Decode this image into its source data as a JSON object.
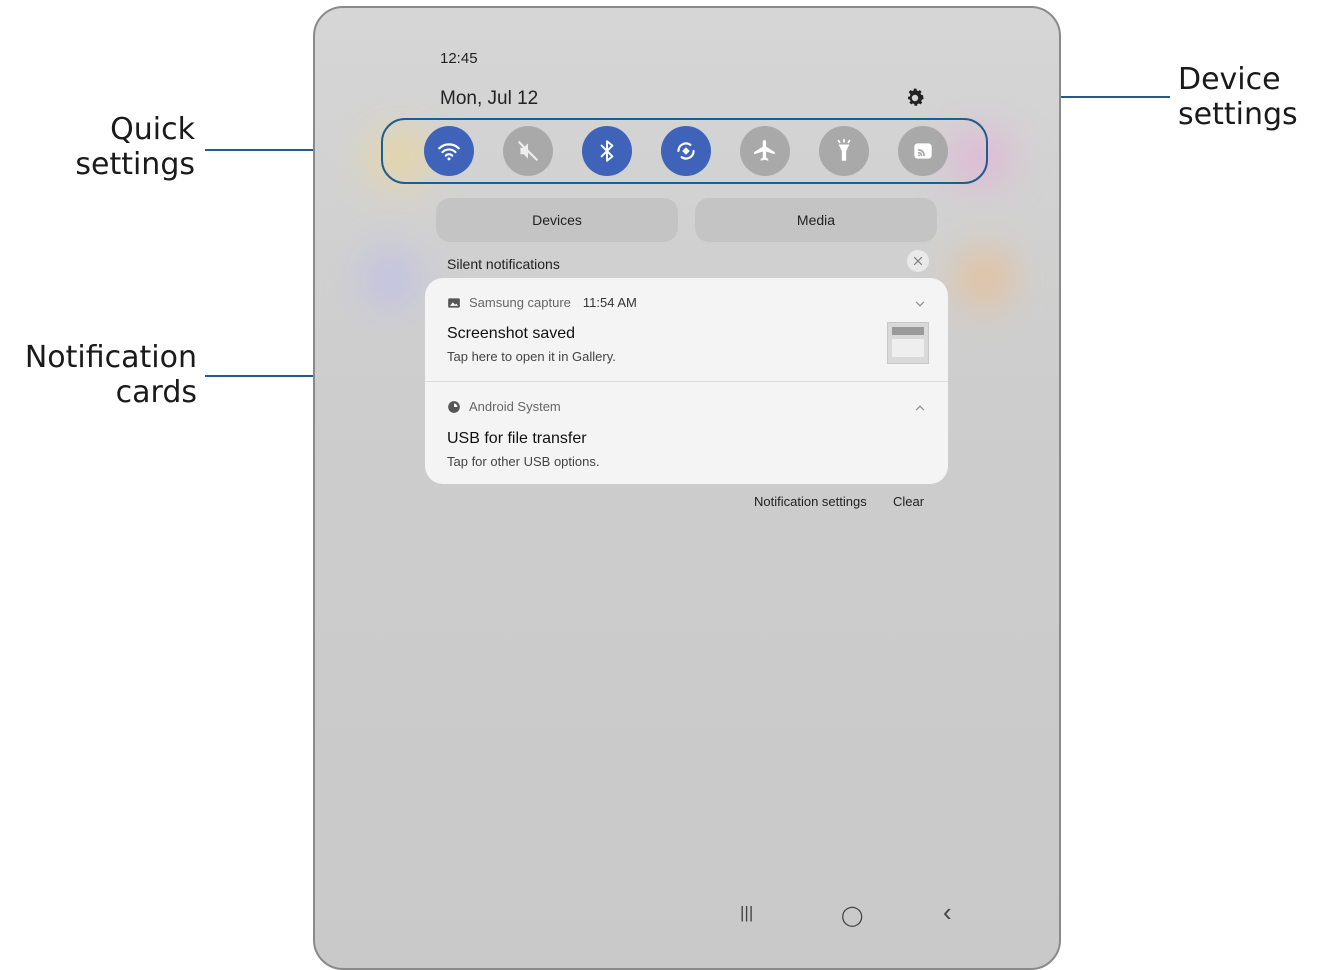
{
  "callouts": {
    "quick_settings_line1": "Quick",
    "quick_settings_line2": "settings",
    "notification_cards_line1": "Notification",
    "notification_cards_line2": "cards",
    "device_settings_line1": "Device",
    "device_settings_line2": "settings",
    "accent_color": "#1f5d8c"
  },
  "status_bar": {
    "time": "12:45"
  },
  "header": {
    "date": "Mon, Jul 12",
    "settings_icon": "gear-icon"
  },
  "quick_settings": [
    {
      "name": "wifi",
      "icon": "wifi-icon",
      "state": "on"
    },
    {
      "name": "sound",
      "icon": "mute-icon",
      "state": "off"
    },
    {
      "name": "bluetooth",
      "icon": "bluetooth-icon",
      "state": "on"
    },
    {
      "name": "auto-rotate",
      "icon": "rotate-icon",
      "state": "on"
    },
    {
      "name": "airplane-mode",
      "icon": "airplane-icon",
      "state": "off"
    },
    {
      "name": "flashlight",
      "icon": "flashlight-icon",
      "state": "off"
    },
    {
      "name": "smart-view",
      "icon": "cast-icon",
      "state": "off"
    }
  ],
  "pills": {
    "devices": "Devices",
    "media": "Media"
  },
  "silent_notifications": {
    "label": "Silent notifications"
  },
  "notifications": [
    {
      "app": "Samsung capture",
      "time": "11:54 AM",
      "title": "Screenshot saved",
      "subtitle": "Tap here to open it in Gallery.",
      "expand_icon": "chevron-down-icon"
    },
    {
      "app": "Android System",
      "title": "USB for file transfer",
      "subtitle": "Tap for other USB options.",
      "expand_icon": "chevron-up-icon"
    }
  ],
  "footer": {
    "notification_settings": "Notification settings",
    "clear": "Clear"
  },
  "nav_bar": {
    "recents": "|||",
    "home": "◯",
    "back": "‹"
  },
  "colors": {
    "toggle_on": "#3e63b8",
    "toggle_off": "#a9a9a9"
  }
}
